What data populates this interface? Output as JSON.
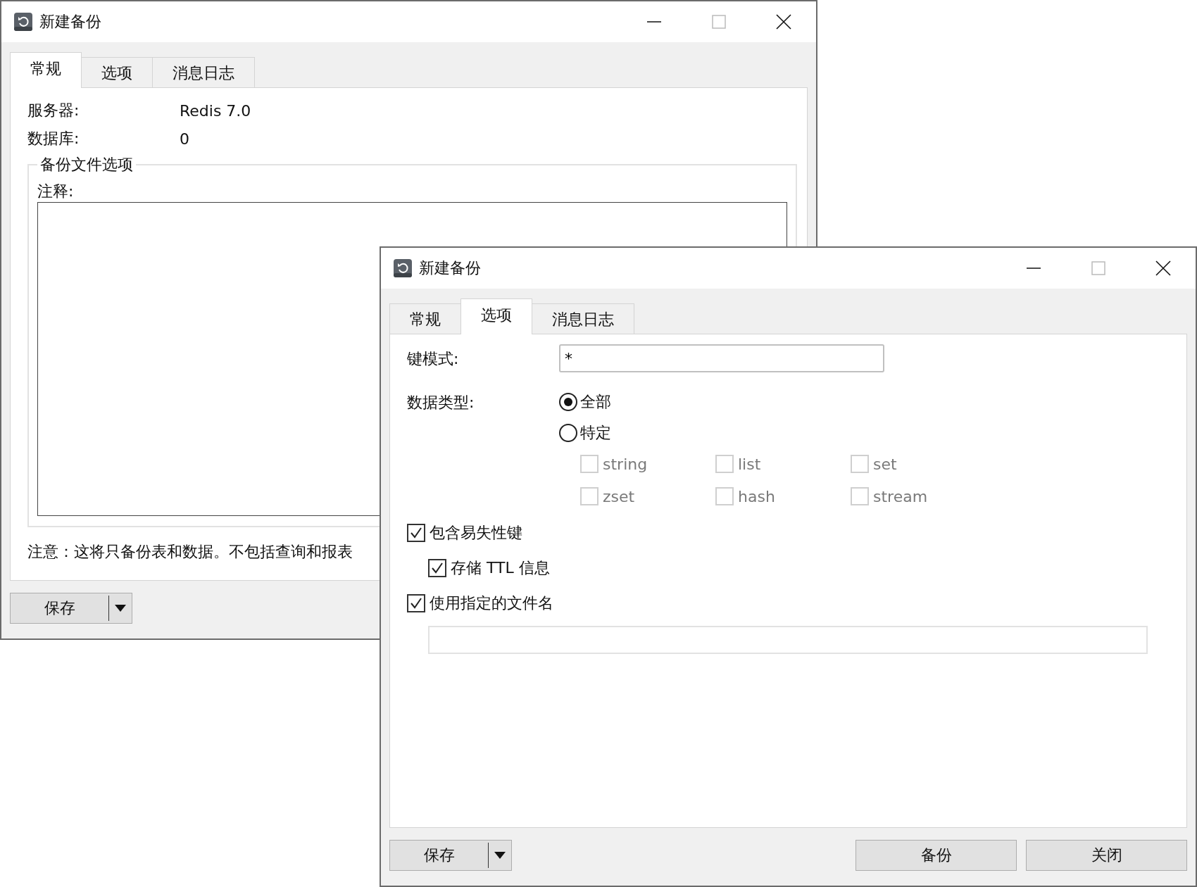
{
  "windows": [
    {
      "kind": "general",
      "title": "新建备份",
      "tabs": [
        {
          "label": "常规",
          "selected": true
        },
        {
          "label": "选项",
          "selected": false
        },
        {
          "label": "消息日志",
          "selected": false
        }
      ],
      "general": {
        "fields": [
          {
            "label": "服务器:",
            "value": "Redis 7.0"
          },
          {
            "label": "数据库:",
            "value": "0"
          }
        ],
        "group_title": "备份文件选项",
        "comment_label": "注释:",
        "note": "注意：这将只备份表和数据。不包括查询和报表"
      },
      "save_button": "保存"
    },
    {
      "kind": "options",
      "title": "新建备份",
      "tabs": [
        {
          "label": "常规",
          "selected": false
        },
        {
          "label": "选项",
          "selected": true
        },
        {
          "label": "消息日志",
          "selected": false
        }
      ],
      "options": {
        "key_pattern": {
          "label": "键模式:",
          "value": "*"
        },
        "data_type_label": "数据类型:",
        "radios": [
          {
            "label": "全部",
            "selected": true
          },
          {
            "label": "特定",
            "selected": false
          }
        ],
        "types": [
          {
            "label": "string",
            "checked": false,
            "disabled": true
          },
          {
            "label": "list",
            "checked": false,
            "disabled": true
          },
          {
            "label": "set",
            "checked": false,
            "disabled": true
          },
          {
            "label": "zset",
            "checked": false,
            "disabled": true
          },
          {
            "label": "hash",
            "checked": false,
            "disabled": true
          },
          {
            "label": "stream",
            "checked": false,
            "disabled": true
          }
        ],
        "checks": [
          {
            "label": "包含易失性键",
            "checked": true,
            "indented": false
          },
          {
            "label": "存储 TTL 信息",
            "checked": true,
            "indented": true
          },
          {
            "label": "使用指定的文件名",
            "checked": true,
            "indented": false
          }
        ]
      },
      "save_button": "保存",
      "buttons": [
        "备份",
        "关闭"
      ]
    }
  ]
}
